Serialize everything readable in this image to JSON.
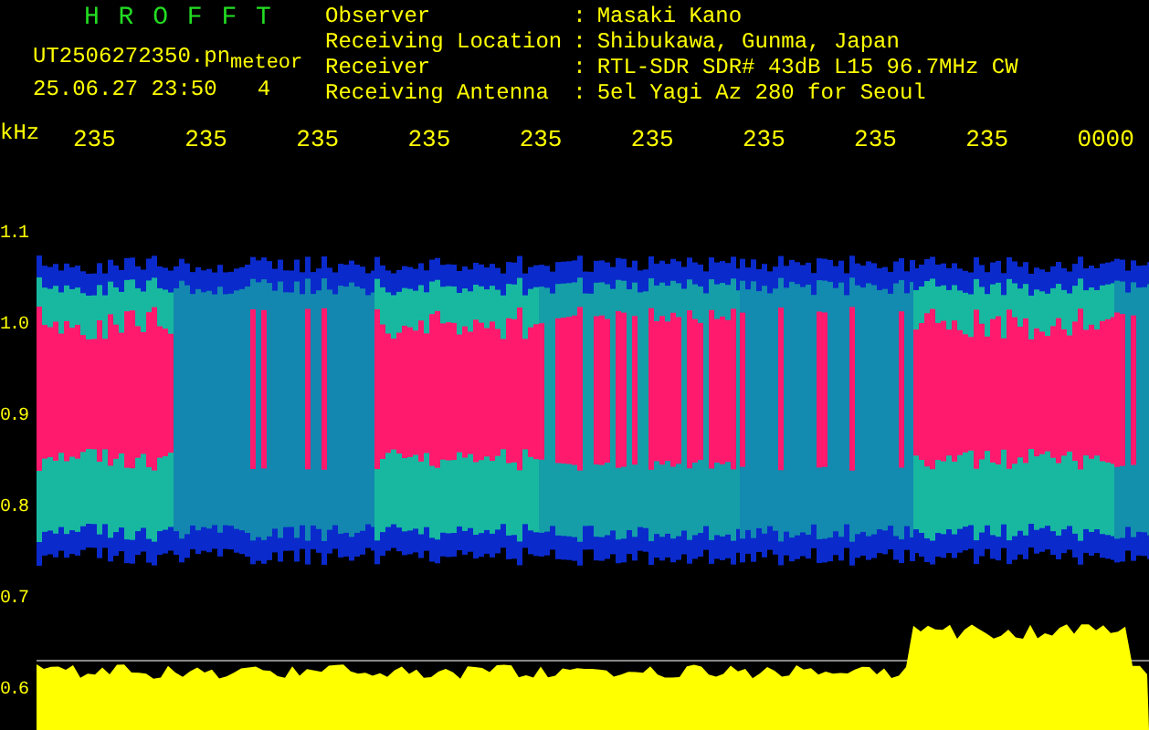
{
  "header": {
    "title": "H R O F F T",
    "file": "UT2506272350.pn",
    "mode": "meteor",
    "datetime": "25.06.27 23:50",
    "count": "4"
  },
  "station_info": [
    {
      "label": "Observer",
      "separator": ":",
      "value": "Masaki Kano"
    },
    {
      "label": "Receiving Location",
      "separator": ":",
      "value": "Shibukawa, Gunma, Japan"
    },
    {
      "label": "Receiver",
      "separator": ":",
      "value": "RTL-SDR SDR# 43dB L15 96.7MHz CW"
    },
    {
      "label": "Receiving Antenna",
      "separator": ":",
      "value": "5el Yagi Az 280 for Seoul"
    }
  ],
  "axis_unit": "kHz",
  "time_labels": [
    "235",
    "235",
    "235",
    "235",
    "235",
    "235",
    "235",
    "235",
    "235",
    "0000"
  ],
  "frequency_labels": [
    "1.1",
    "1.0",
    "0.9",
    "0.8",
    "0.7",
    "0.6"
  ]
}
